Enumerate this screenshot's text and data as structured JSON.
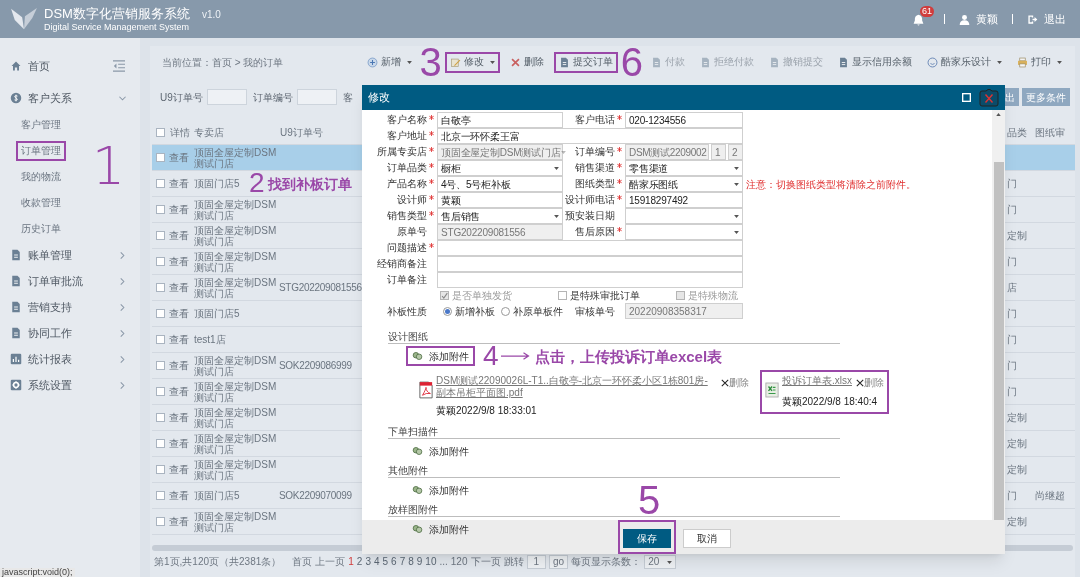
{
  "header": {
    "title": "DSM数字化营销服务系统",
    "version": "v1.0",
    "subtitle": "Digital Service Management System",
    "notification_count": "61",
    "user": "黄颖",
    "logout": "退出"
  },
  "sidebar": {
    "items": [
      {
        "label": "首页",
        "kind": "home"
      },
      {
        "label": "客户关系",
        "kind": "finance",
        "expanded": true,
        "children": [
          {
            "label": "客户管理",
            "highlighted": false
          },
          {
            "label": "订单管理",
            "highlighted": true
          },
          {
            "label": "我的物流",
            "highlighted": false
          },
          {
            "label": "收款管理",
            "highlighted": false
          },
          {
            "label": "历史订单",
            "highlighted": false
          }
        ]
      },
      {
        "label": "账单管理",
        "kind": "document",
        "expanded": false
      },
      {
        "label": "订单审批流",
        "kind": "document",
        "expanded": false
      },
      {
        "label": "营销支持",
        "kind": "document",
        "expanded": false
      },
      {
        "label": "协同工作",
        "kind": "document",
        "expanded": false
      },
      {
        "label": "统计报表",
        "kind": "report",
        "expanded": false
      },
      {
        "label": "系统设置",
        "kind": "settings",
        "expanded": false
      }
    ]
  },
  "breadcrumb": "当前位置：首页 > 我的订单",
  "toolbar": [
    {
      "label": "新增",
      "kind": "add",
      "disabled": false,
      "dropdown": true,
      "highlighted": false
    },
    {
      "label": "修改",
      "kind": "edit",
      "disabled": false,
      "dropdown": true,
      "highlighted": true
    },
    {
      "label": "删除",
      "kind": "delete",
      "disabled": false,
      "dropdown": false,
      "highlighted": false
    },
    {
      "label": "提交订单",
      "kind": "document",
      "disabled": false,
      "dropdown": false,
      "highlighted": true
    },
    {
      "label": "付款",
      "kind": "document",
      "disabled": true,
      "dropdown": false,
      "highlighted": false
    },
    {
      "label": "拒绝付款",
      "kind": "document",
      "disabled": true,
      "dropdown": false,
      "highlighted": false
    },
    {
      "label": "撤销提交",
      "kind": "document",
      "disabled": true,
      "dropdown": false,
      "highlighted": false
    },
    {
      "label": "显示信用余额",
      "kind": "document",
      "disabled": false,
      "dropdown": false,
      "highlighted": false
    },
    {
      "label": "酷家乐设计",
      "kind": "design",
      "disabled": false,
      "dropdown": true,
      "highlighted": false
    },
    {
      "label": "打印",
      "kind": "print",
      "disabled": false,
      "dropdown": true,
      "highlighted": false
    }
  ],
  "search": {
    "fields": [
      {
        "label": "U9订单号"
      },
      {
        "label": "订单编号"
      },
      {
        "label": "客"
      }
    ],
    "buttons": [
      "出",
      "更多条件"
    ]
  },
  "table": {
    "all_selected": false,
    "columns": [
      "详情",
      "专卖店",
      "U9订单号",
      "品类",
      "图纸审"
    ],
    "rows": [
      {
        "selected": true,
        "action": "查看",
        "store": "顶固全屋定制DSM测试门店",
        "u9": "",
        "column_4": "",
        "column_5": ""
      },
      {
        "selected": false,
        "action": "查看",
        "store": "顶固门店5",
        "u9": "",
        "column_4": "门",
        "column_5": ""
      },
      {
        "selected": false,
        "action": "查看",
        "store": "顶固全屋定制DSM测试门店",
        "u9": "",
        "column_4": "门",
        "column_5": ""
      },
      {
        "selected": false,
        "action": "查看",
        "store": "顶固全屋定制DSM测试门店",
        "u9": "",
        "column_4": "定制",
        "column_5": ""
      },
      {
        "selected": false,
        "action": "查看",
        "store": "顶固全屋定制DSM测试门店",
        "u9": "",
        "column_4": "门",
        "column_5": ""
      },
      {
        "selected": false,
        "action": "查看",
        "store": "顶固全屋定制DSM测试门店",
        "u9": "STG202209081556",
        "column_4": "店",
        "column_5": ""
      },
      {
        "selected": false,
        "action": "查看",
        "store": "顶固门店5",
        "u9": "",
        "column_4": "门",
        "column_5": ""
      },
      {
        "selected": false,
        "action": "查看",
        "store": "test1店",
        "u9": "",
        "column_4": "门",
        "column_5": ""
      },
      {
        "selected": false,
        "action": "查看",
        "store": "顶固全屋定制DSM测试门店",
        "u9": "SOK2209086999",
        "column_4": "门",
        "column_5": ""
      },
      {
        "selected": false,
        "action": "查看",
        "store": "顶固全屋定制DSM测试门店",
        "u9": "",
        "column_4": "门",
        "column_5": ""
      },
      {
        "selected": false,
        "action": "查看",
        "store": "顶固全屋定制DSM测试门店",
        "u9": "",
        "column_4": "定制",
        "column_5": ""
      },
      {
        "selected": false,
        "action": "查看",
        "store": "顶固全屋定制DSM测试门店",
        "u9": "",
        "column_4": "定制",
        "column_5": ""
      },
      {
        "selected": false,
        "action": "查看",
        "store": "顶固全屋定制DSM测试门店",
        "u9": "",
        "column_4": "定制",
        "column_5": ""
      },
      {
        "selected": false,
        "action": "查看",
        "store": "顶固门店5",
        "u9": "SOK2209070099",
        "column_4": "门",
        "column_5": "尚继超"
      },
      {
        "selected": false,
        "action": "查看",
        "store": "顶固全屋定制DSM测试门店",
        "u9": "",
        "column_4": "定制",
        "column_5": ""
      }
    ]
  },
  "pagination": {
    "summary": "第1页,共120页（共2381条）",
    "first": "首页",
    "prev": "上一页",
    "pages": [
      {
        "label": "1",
        "selected": true
      },
      {
        "label": "2",
        "selected": false
      },
      {
        "label": "3",
        "selected": false
      },
      {
        "label": "4",
        "selected": false
      },
      {
        "label": "5",
        "selected": false
      },
      {
        "label": "6",
        "selected": false
      },
      {
        "label": "7",
        "selected": false
      },
      {
        "label": "8",
        "selected": false
      },
      {
        "label": "9",
        "selected": false
      },
      {
        "label": "10",
        "selected": false
      }
    ],
    "ellipsis": "...",
    "last": "120",
    "next": "下一页",
    "jump_label": "跳转",
    "jump_value": "1",
    "go": "go",
    "size_label": "每页显示条数：",
    "size_value": "20"
  },
  "status_bar": "javascript:void(0);",
  "modal": {
    "title": "修改",
    "rows": [
      {
        "fields": [
          {
            "label": "客户名称",
            "required": true,
            "kind": "text",
            "value": "白敬亭",
            "disabled": false
          },
          {
            "label": "客户电话",
            "required": true,
            "kind": "text",
            "value": "020-1234556",
            "disabled": false
          }
        ]
      },
      {
        "fields": [
          {
            "label": "客户地址",
            "required": true,
            "kind": "wide",
            "value": "北京一环怀柔王富",
            "disabled": false
          }
        ]
      },
      {
        "fields": [
          {
            "label": "所属专卖店",
            "required": true,
            "kind": "select",
            "value": "顶固全屋定制DSM测试门店",
            "disabled": true
          },
          {
            "label": "订单编号",
            "required": true,
            "kind": "code",
            "value": "DSM测试2209002",
            "extra": [
              "1",
              "2"
            ],
            "disabled": true
          }
        ]
      },
      {
        "fields": [
          {
            "label": "订单品类",
            "required": true,
            "kind": "select",
            "value": "橱柜",
            "disabled": false
          },
          {
            "label": "销售渠道",
            "required": true,
            "kind": "select",
            "value": "零售渠道",
            "disabled": false
          }
        ]
      },
      {
        "fields": [
          {
            "label": "产品名称",
            "required": true,
            "kind": "text",
            "value": "4号、5号柜补板",
            "disabled": false
          },
          {
            "label": "图纸类型",
            "required": true,
            "kind": "select",
            "value": "酷家乐图纸",
            "disabled": false
          }
        ],
        "note": "注意：切换图纸类型将清除之前附件。"
      },
      {
        "fields": [
          {
            "label": "设计师",
            "required": true,
            "kind": "text",
            "value": "黄颖",
            "disabled": false
          },
          {
            "label": "设计师电话",
            "required": true,
            "kind": "text",
            "value": "15918297492",
            "disabled": false
          }
        ]
      },
      {
        "fields": [
          {
            "label": "销售类型",
            "required": true,
            "kind": "select",
            "value": "售后销售",
            "disabled": false
          },
          {
            "label": "预安装日期",
            "required": false,
            "kind": "select",
            "disabled": false
          }
        ]
      },
      {
        "fields": [
          {
            "label": "原单号",
            "required": false,
            "kind": "text",
            "value": "STG202209081556",
            "disabled": true
          },
          {
            "label": "售后原因",
            "required": true,
            "kind": "select",
            "disabled": false
          }
        ]
      },
      {
        "fields": [
          {
            "label": "问题描述",
            "required": true,
            "kind": "wide",
            "disabled": false
          }
        ]
      },
      {
        "fields": [
          {
            "label": "经销商备注",
            "required": false,
            "kind": "wide",
            "disabled": false
          }
        ]
      },
      {
        "fields": [
          {
            "label": "订单备注",
            "required": false,
            "kind": "wide",
            "disabled": false
          }
        ]
      }
    ],
    "checkboxes": [
      {
        "label": "是否单独发货",
        "checked": true,
        "disabled": true
      },
      {
        "label": "是特殊审批订单",
        "checked": false,
        "disabled": false
      },
      {
        "label": "是特殊物流",
        "checked": false,
        "disabled": true
      }
    ],
    "radio_group": {
      "label": "补板性质",
      "options": [
        {
          "label": "新增补板",
          "selected": true
        },
        {
          "label": "补原单板件",
          "selected": false
        }
      ]
    },
    "review_number": {
      "label": "审核单号",
      "value": "20220908358317"
    },
    "attachments": [
      {
        "title": "设计图纸",
        "add_label": "添加附件",
        "highlighted": true,
        "files": [
          {
            "kind": "pdf",
            "name": "DSM测试22090026L-T1..白敬亭-北京一环怀柔小区1栋801房-副本吊柜平面图.pdf",
            "delete": "删除",
            "meta": "黄颖2022/9/8 18:33:01",
            "highlighted": false
          },
          {
            "kind": "excel",
            "name": "投诉订单表.xlsx",
            "delete": "删除",
            "meta": "黄颖2022/9/8 18:40:4",
            "highlighted": true
          }
        ]
      },
      {
        "title": "下单扫描件",
        "add_label": "添加附件",
        "highlighted": false
      },
      {
        "title": "其他附件",
        "add_label": "添加附件",
        "highlighted": false
      },
      {
        "title": "放样图附件",
        "add_label": "添加附件",
        "highlighted": false
      }
    ],
    "buttons": [
      {
        "label": "保存",
        "kind": "primary",
        "highlighted": true
      },
      {
        "label": "取消",
        "kind": "default",
        "highlighted": false
      }
    ]
  },
  "annotations": [
    {
      "text": "1"
    },
    {
      "text": "2"
    },
    {
      "text": "找到补板订单"
    },
    {
      "text": "3"
    },
    {
      "text": "6"
    },
    {
      "text": "4"
    },
    {
      "text": "点击，上传投诉订单excel表"
    },
    {
      "text": "5"
    }
  ]
}
